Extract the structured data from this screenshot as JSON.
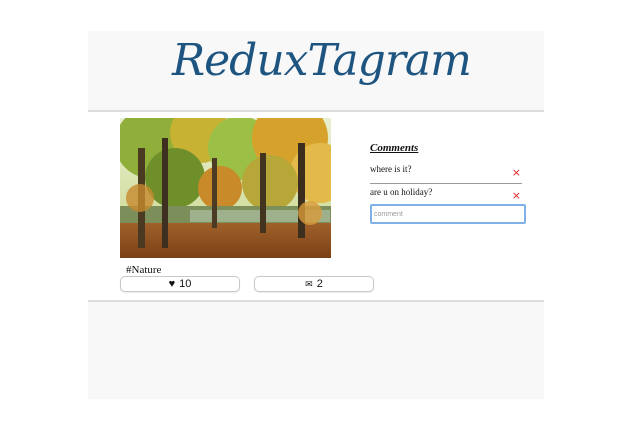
{
  "app": {
    "title": "ReduxTagram"
  },
  "post": {
    "caption": "#Nature",
    "image_alt": "autumn forest by a lake",
    "likes_icon": "heart-icon",
    "likes": "10",
    "comments_icon": "envelope-icon",
    "comments_count": "2"
  },
  "comments": {
    "title": "Comments",
    "items": [
      {
        "text": "where is it?",
        "remove": "×"
      },
      {
        "text": "are u on holiday?",
        "remove": "×"
      }
    ],
    "input_placeholder": "comment"
  },
  "colors": {
    "brand": "#1e5480",
    "remove": "#e02020",
    "focus": "#7fb0e8"
  }
}
